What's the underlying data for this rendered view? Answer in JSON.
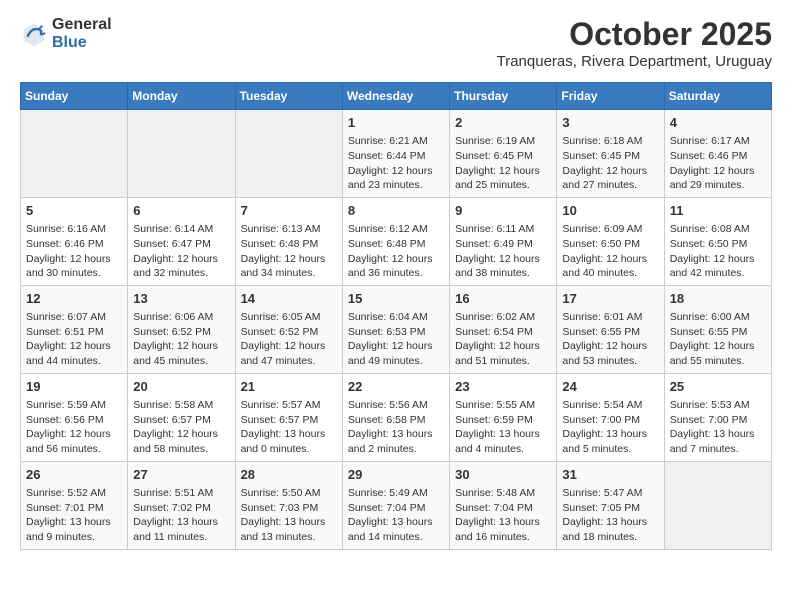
{
  "logo": {
    "text_general": "General",
    "text_blue": "Blue"
  },
  "header": {
    "month": "October 2025",
    "subtitle": "Tranqueras, Rivera Department, Uruguay"
  },
  "days_of_week": [
    "Sunday",
    "Monday",
    "Tuesday",
    "Wednesday",
    "Thursday",
    "Friday",
    "Saturday"
  ],
  "weeks": [
    [
      {
        "day": "",
        "content": ""
      },
      {
        "day": "",
        "content": ""
      },
      {
        "day": "",
        "content": ""
      },
      {
        "day": "1",
        "content": "Sunrise: 6:21 AM\nSunset: 6:44 PM\nDaylight: 12 hours\nand 23 minutes."
      },
      {
        "day": "2",
        "content": "Sunrise: 6:19 AM\nSunset: 6:45 PM\nDaylight: 12 hours\nand 25 minutes."
      },
      {
        "day": "3",
        "content": "Sunrise: 6:18 AM\nSunset: 6:45 PM\nDaylight: 12 hours\nand 27 minutes."
      },
      {
        "day": "4",
        "content": "Sunrise: 6:17 AM\nSunset: 6:46 PM\nDaylight: 12 hours\nand 29 minutes."
      }
    ],
    [
      {
        "day": "5",
        "content": "Sunrise: 6:16 AM\nSunset: 6:46 PM\nDaylight: 12 hours\nand 30 minutes."
      },
      {
        "day": "6",
        "content": "Sunrise: 6:14 AM\nSunset: 6:47 PM\nDaylight: 12 hours\nand 32 minutes."
      },
      {
        "day": "7",
        "content": "Sunrise: 6:13 AM\nSunset: 6:48 PM\nDaylight: 12 hours\nand 34 minutes."
      },
      {
        "day": "8",
        "content": "Sunrise: 6:12 AM\nSunset: 6:48 PM\nDaylight: 12 hours\nand 36 minutes."
      },
      {
        "day": "9",
        "content": "Sunrise: 6:11 AM\nSunset: 6:49 PM\nDaylight: 12 hours\nand 38 minutes."
      },
      {
        "day": "10",
        "content": "Sunrise: 6:09 AM\nSunset: 6:50 PM\nDaylight: 12 hours\nand 40 minutes."
      },
      {
        "day": "11",
        "content": "Sunrise: 6:08 AM\nSunset: 6:50 PM\nDaylight: 12 hours\nand 42 minutes."
      }
    ],
    [
      {
        "day": "12",
        "content": "Sunrise: 6:07 AM\nSunset: 6:51 PM\nDaylight: 12 hours\nand 44 minutes."
      },
      {
        "day": "13",
        "content": "Sunrise: 6:06 AM\nSunset: 6:52 PM\nDaylight: 12 hours\nand 45 minutes."
      },
      {
        "day": "14",
        "content": "Sunrise: 6:05 AM\nSunset: 6:52 PM\nDaylight: 12 hours\nand 47 minutes."
      },
      {
        "day": "15",
        "content": "Sunrise: 6:04 AM\nSunset: 6:53 PM\nDaylight: 12 hours\nand 49 minutes."
      },
      {
        "day": "16",
        "content": "Sunrise: 6:02 AM\nSunset: 6:54 PM\nDaylight: 12 hours\nand 51 minutes."
      },
      {
        "day": "17",
        "content": "Sunrise: 6:01 AM\nSunset: 6:55 PM\nDaylight: 12 hours\nand 53 minutes."
      },
      {
        "day": "18",
        "content": "Sunrise: 6:00 AM\nSunset: 6:55 PM\nDaylight: 12 hours\nand 55 minutes."
      }
    ],
    [
      {
        "day": "19",
        "content": "Sunrise: 5:59 AM\nSunset: 6:56 PM\nDaylight: 12 hours\nand 56 minutes."
      },
      {
        "day": "20",
        "content": "Sunrise: 5:58 AM\nSunset: 6:57 PM\nDaylight: 12 hours\nand 58 minutes."
      },
      {
        "day": "21",
        "content": "Sunrise: 5:57 AM\nSunset: 6:57 PM\nDaylight: 13 hours\nand 0 minutes."
      },
      {
        "day": "22",
        "content": "Sunrise: 5:56 AM\nSunset: 6:58 PM\nDaylight: 13 hours\nand 2 minutes."
      },
      {
        "day": "23",
        "content": "Sunrise: 5:55 AM\nSunset: 6:59 PM\nDaylight: 13 hours\nand 4 minutes."
      },
      {
        "day": "24",
        "content": "Sunrise: 5:54 AM\nSunset: 7:00 PM\nDaylight: 13 hours\nand 5 minutes."
      },
      {
        "day": "25",
        "content": "Sunrise: 5:53 AM\nSunset: 7:00 PM\nDaylight: 13 hours\nand 7 minutes."
      }
    ],
    [
      {
        "day": "26",
        "content": "Sunrise: 5:52 AM\nSunset: 7:01 PM\nDaylight: 13 hours\nand 9 minutes."
      },
      {
        "day": "27",
        "content": "Sunrise: 5:51 AM\nSunset: 7:02 PM\nDaylight: 13 hours\nand 11 minutes."
      },
      {
        "day": "28",
        "content": "Sunrise: 5:50 AM\nSunset: 7:03 PM\nDaylight: 13 hours\nand 13 minutes."
      },
      {
        "day": "29",
        "content": "Sunrise: 5:49 AM\nSunset: 7:04 PM\nDaylight: 13 hours\nand 14 minutes."
      },
      {
        "day": "30",
        "content": "Sunrise: 5:48 AM\nSunset: 7:04 PM\nDaylight: 13 hours\nand 16 minutes."
      },
      {
        "day": "31",
        "content": "Sunrise: 5:47 AM\nSunset: 7:05 PM\nDaylight: 13 hours\nand 18 minutes."
      },
      {
        "day": "",
        "content": ""
      }
    ]
  ]
}
